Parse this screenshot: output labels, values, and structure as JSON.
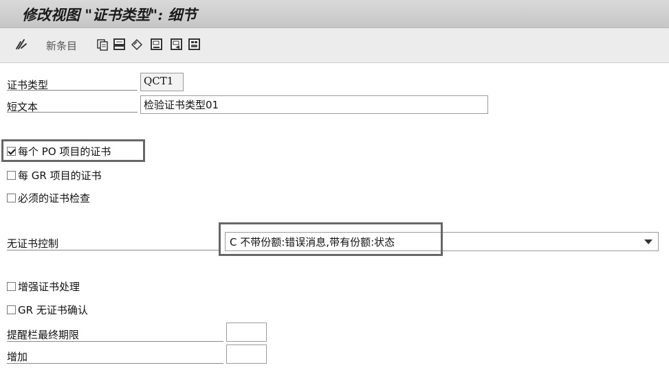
{
  "window": {
    "title": "修改视图 \"证书类型\": 细节"
  },
  "toolbar": {
    "new_entries_label": "新条目"
  },
  "form": {
    "cert_type": {
      "label": "证书类型",
      "value": "QCT1"
    },
    "short_text": {
      "label": "短文本",
      "value": "检验证书类型01"
    },
    "checkboxes": [
      {
        "label": "每个 PO 项目的证书",
        "checked": true
      },
      {
        "label": "每 GR 项目的证书",
        "checked": false
      },
      {
        "label": "必须的证书检查",
        "checked": false
      }
    ],
    "no_cert_control": {
      "label": "无证书控制",
      "value": "C 不带份额:错误消息,带有份额:状态"
    },
    "checkboxes2": [
      {
        "label": "增强证书处理",
        "checked": false
      },
      {
        "label": "GR 无证书确认",
        "checked": false
      }
    ],
    "reminder_deadline": {
      "label": "提醒栏最终期限",
      "value": ""
    },
    "increase": {
      "label": "增加",
      "value": ""
    }
  }
}
